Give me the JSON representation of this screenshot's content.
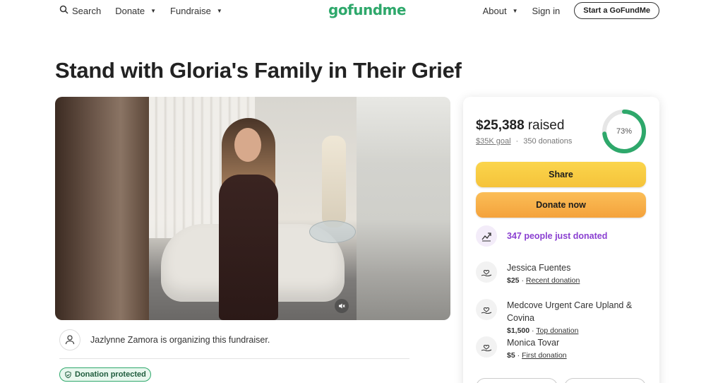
{
  "nav": {
    "search_label": "Search",
    "donate_label": "Donate",
    "fundraise_label": "Fundraise",
    "logo_text": "gofundme",
    "about_label": "About",
    "signin_label": "Sign in",
    "start_label": "Start a GoFundMe"
  },
  "page": {
    "title": "Stand with Gloria's Family in Their Grief"
  },
  "organizer": {
    "text": "Jazlynne Zamora is organizing this fundraiser."
  },
  "badge": {
    "protected_label": "Donation protected"
  },
  "donation": {
    "raised_amount": "$25,388",
    "raised_word": "raised",
    "goal_text": "$35K goal",
    "separator": "·",
    "donations_text": "350 donations",
    "progress_percent": 73,
    "progress_label": "73%",
    "share_label": "Share",
    "donate_label": "Donate now",
    "trend_text": "347 people just donated"
  },
  "donors": [
    {
      "name": "Jessica Fuentes",
      "amount": "$25",
      "tag": "Recent donation"
    },
    {
      "name": "Medcove Urgent Care Upland & Covina",
      "amount": "$1,500",
      "tag": "Top donation"
    },
    {
      "name": "Monica Tovar",
      "amount": "$5",
      "tag": "First donation"
    }
  ],
  "colors": {
    "brand_green": "#2ea86b",
    "share_yellow": "#f5c33a",
    "donate_orange": "#f4a23c",
    "trend_purple": "#8a3fd1"
  },
  "icons": {
    "search": "search-icon",
    "organizer": "user-icon",
    "protected": "shield-check-icon",
    "trend": "trending-up-icon",
    "donor": "heart-hand-icon",
    "mute": "volume-mute-icon"
  }
}
